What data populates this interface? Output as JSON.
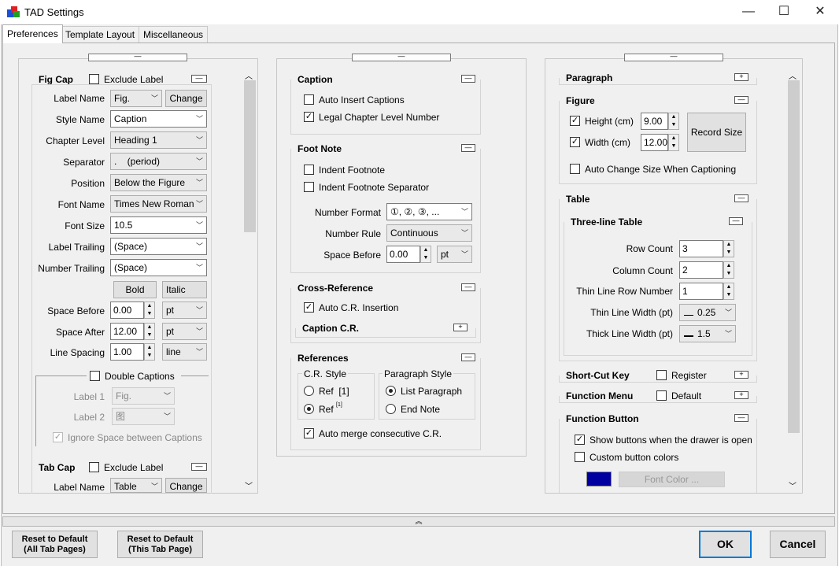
{
  "window": {
    "title": "TAD Settings",
    "minimize": "—",
    "maximize": "☐",
    "close": "✕"
  },
  "tabs": [
    "Preferences",
    "Template Layout",
    "Miscellaneous"
  ],
  "collapse_symbol": "—",
  "expand_symbol": "+",
  "expand_up_symbol": "︽",
  "left": {
    "figcap": {
      "title": "Fig Cap",
      "exclude_label": "Exclude Label",
      "label_name": "Label Name",
      "label_value": "Fig.",
      "change": "Change",
      "style_name": "Style Name",
      "style_value": "Caption",
      "chapter_level": "Chapter Level",
      "chapter_value": "Heading 1",
      "separator": "Separator",
      "separator_value": ".    (period)",
      "position": "Position",
      "position_value": "Below the Figure",
      "font_name": "Font Name",
      "font_value": "Times New Roman",
      "font_size": "Font Size",
      "font_size_value": "10.5",
      "label_trailing": "Label Trailing",
      "label_trailing_value": "(Space)",
      "number_trailing": "Number Trailing",
      "number_trailing_value": "(Space)",
      "bold": "Bold",
      "italic": "Italic",
      "space_before": "Space Before",
      "space_before_value": "0.00",
      "space_before_unit": "pt",
      "space_after": "Space After",
      "space_after_value": "12.00",
      "space_after_unit": "pt",
      "line_spacing": "Line Spacing",
      "line_spacing_value": "1.00",
      "line_spacing_unit": "line"
    },
    "double": {
      "title": "Double Captions",
      "label1": "Label 1",
      "label1_value": "Fig.",
      "label2": "Label 2",
      "label2_value": "图",
      "ignore": "Ignore Space between Captions"
    },
    "tabcap": {
      "title": "Tab Cap",
      "exclude_label": "Exclude Label",
      "label_name": "Label Name",
      "label_value": "Table",
      "change": "Change"
    }
  },
  "middle": {
    "caption": {
      "title": "Caption",
      "auto_insert": "Auto Insert Captions",
      "legal": "Legal Chapter Level Number"
    },
    "footnote": {
      "title": "Foot Note",
      "indent": "Indent Footnote",
      "indent_sep": "Indent Footnote Separator",
      "number_format": "Number Format",
      "number_format_value": "①, ②, ③, ...",
      "number_rule": "Number Rule",
      "number_rule_value": "Continuous",
      "space_before": "Space Before",
      "space_before_value": "0.00",
      "space_before_unit": "pt"
    },
    "crossref": {
      "title": "Cross-Reference",
      "auto": "Auto C.R. Insertion",
      "caption_cr": "Caption C.R."
    },
    "references": {
      "title": "References",
      "cr_style": "C.R. Style",
      "ref1": "Ref  [1]",
      "ref2": "Ref",
      "ref2_sup": "[1]",
      "para_style": "Paragraph Style",
      "list_para": "List Paragraph",
      "end_note": "End Note",
      "auto_merge": "Auto merge consecutive C.R."
    }
  },
  "right": {
    "paragraph": {
      "title": "Paragraph"
    },
    "figure": {
      "title": "Figure",
      "height": "Height (cm)",
      "height_value": "9.00",
      "width": "Width (cm)",
      "width_value": "12.00",
      "record": "Record Size",
      "auto_change": "Auto Change Size When Captioning"
    },
    "table": {
      "title": "Table",
      "threeline": "Three-line Table",
      "row_count": "Row Count",
      "row_count_value": "3",
      "col_count": "Column Count",
      "col_count_value": "2",
      "thin_row": "Thin Line Row Number",
      "thin_row_value": "1",
      "thin_width": "Thin Line Width (pt)",
      "thin_width_value": "0.25",
      "thick_width": "Thick Line Width (pt)",
      "thick_width_value": "1.5"
    },
    "shortcut": {
      "title": "Short-Cut Key",
      "register": "Register"
    },
    "function_menu": {
      "title": "Function Menu",
      "default": "Default"
    },
    "function_button": {
      "title": "Function Button",
      "show": "Show buttons when the drawer is open",
      "custom": "Custom button colors",
      "font_color": "Font Color ..."
    }
  },
  "footer": {
    "reset_all_1": "Reset to Default",
    "reset_all_2": "(All Tab Pages)",
    "reset_this_1": "Reset to Default",
    "reset_this_2": "(This Tab Page)",
    "ok": "OK",
    "cancel": "Cancel"
  },
  "colors": {
    "swatch": "#0000a0"
  }
}
